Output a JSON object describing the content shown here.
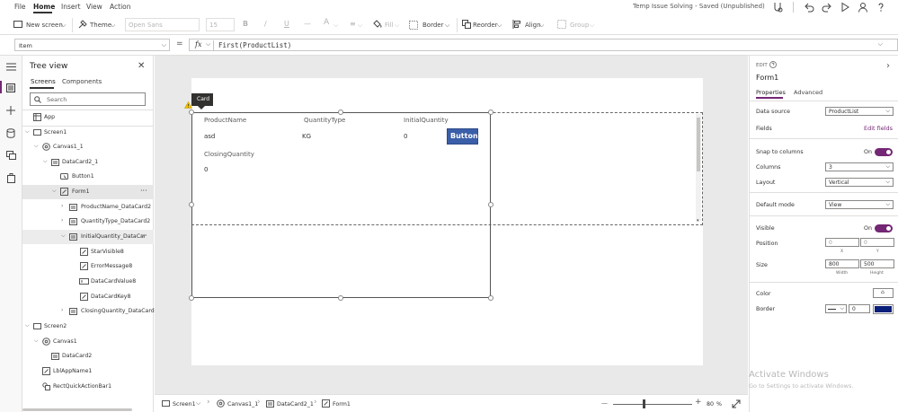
{
  "menubar": {
    "items": [
      "File",
      "Home",
      "Insert",
      "View",
      "Action"
    ],
    "doc_title": "Temp Issue Solving - Saved (Unpublished)"
  },
  "toolbar": {
    "new_screen": "New screen",
    "theme": "Theme",
    "font": "Open Sans",
    "font_size": "15",
    "bold": "B",
    "italic": "/",
    "underline": "U",
    "strike": "—",
    "fill": "Fill",
    "border": "Border",
    "reorder": "Reorder",
    "align": "Align",
    "group": "Group"
  },
  "formula": {
    "property": "Item",
    "equals": "=",
    "fx": "fx",
    "expression": "First(ProductList)"
  },
  "tree": {
    "title": "Tree view",
    "tabs": [
      "Screens",
      "Components"
    ],
    "search_placeholder": "Search",
    "items": [
      {
        "label": "App"
      },
      {
        "label": "Screen1"
      },
      {
        "label": "Canvas1_1"
      },
      {
        "label": "DataCard2_1"
      },
      {
        "label": "Button1"
      },
      {
        "label": "Form1",
        "more": "···"
      },
      {
        "label": "ProductName_DataCard2"
      },
      {
        "label": "QuantityType_DataCard2"
      },
      {
        "label": "InitialQuantity_DataCar",
        "more": "···"
      },
      {
        "label": "StarVisible8"
      },
      {
        "label": "ErrorMessage8"
      },
      {
        "label": "DataCardValue8"
      },
      {
        "label": "DataCardKey8"
      },
      {
        "label": "ClosingQuantity_DataCard2"
      },
      {
        "label": "Screen2"
      },
      {
        "label": "Canvas1"
      },
      {
        "label": "DataCard2"
      },
      {
        "label": "LblAppName1"
      },
      {
        "label": "RectQuickActionBar1"
      }
    ]
  },
  "canvas": {
    "tooltip": "Card",
    "headers": [
      "ProductName",
      "QuantityType",
      "InitialQuantity"
    ],
    "values": [
      "asd",
      "KG",
      "0"
    ],
    "button_label": "Button",
    "closing_label": "ClosingQuantity",
    "closing_value": "0"
  },
  "status": {
    "crumbs": [
      "Screen1",
      "Canvas1_1",
      "DataCard2_1",
      "Form1"
    ],
    "zoom_minus": "—",
    "zoom_plus": "+",
    "zoom": "80",
    "zoom_unit": "%"
  },
  "props": {
    "edit_label": "EDIT",
    "name": "Form1",
    "tabs": [
      "Properties",
      "Advanced"
    ],
    "data_source_label": "Data source",
    "data_source": "ProductList",
    "fields_label": "Fields",
    "edit_fields": "Edit fields",
    "snap_label": "Snap to columns",
    "snap_state": "On",
    "columns_label": "Columns",
    "columns": "3",
    "layout_label": "Layout",
    "layout": "Vertical",
    "default_mode_label": "Default mode",
    "default_mode": "View",
    "visible_label": "Visible",
    "visible_state": "On",
    "position_label": "Position",
    "pos_x": "0",
    "pos_y": "0",
    "x_caption": "X",
    "y_caption": "Y",
    "size_label": "Size",
    "width": "800",
    "height": "500",
    "width_caption": "Width",
    "height_caption": "Height",
    "color_label": "Color",
    "border_label": "Border",
    "border_width": "0",
    "border_color": "#0a1f7a",
    "accent": "#742774",
    "button_color": "#3b5ea8"
  },
  "watermark": {
    "title": "Activate Windows",
    "subtitle": "Go to Settings to activate Windows."
  }
}
